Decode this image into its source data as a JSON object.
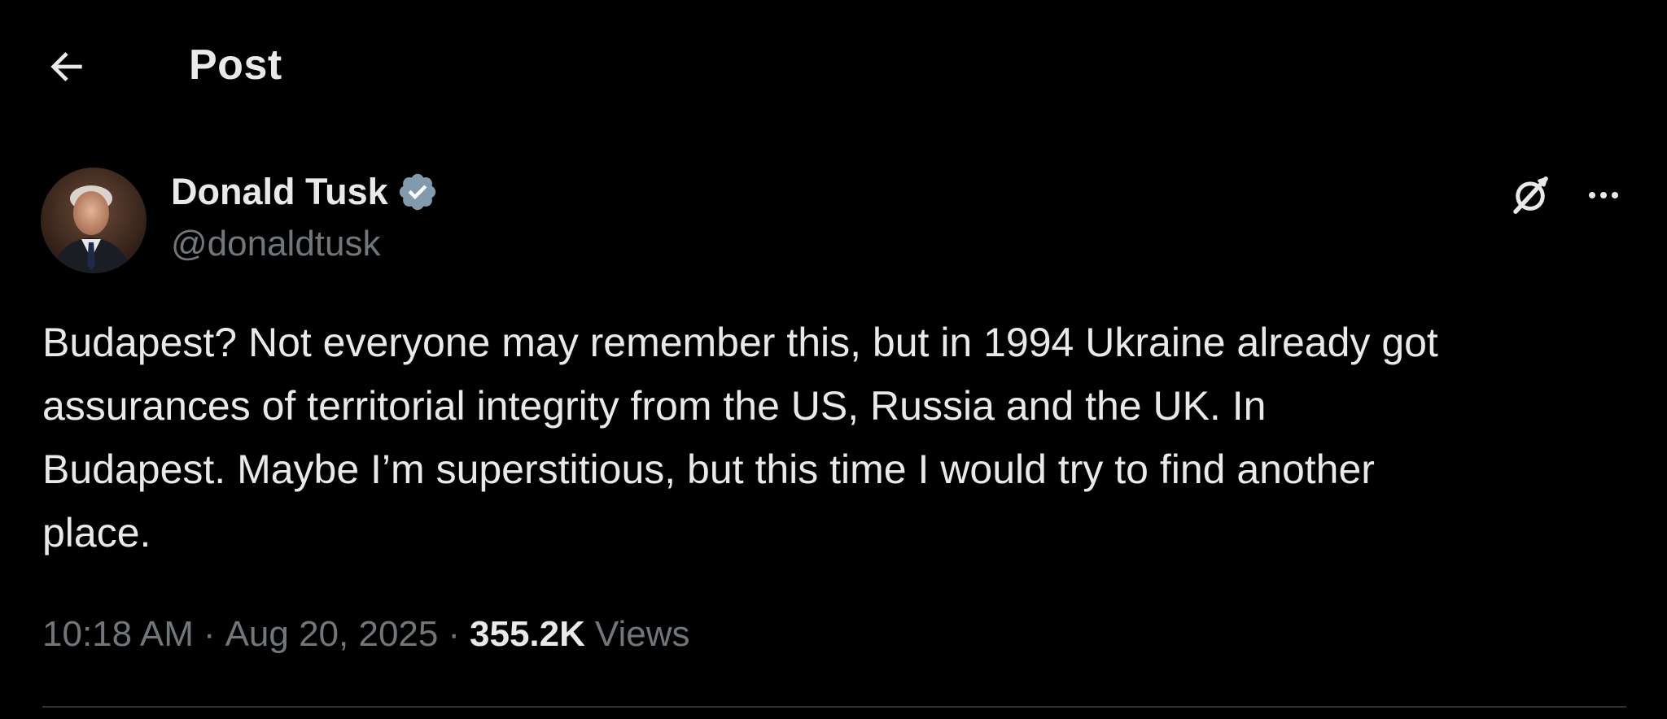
{
  "header": {
    "back_icon": "arrow-left-icon",
    "title": "Post"
  },
  "author": {
    "name": "Donald Tusk",
    "handle": "@donaldtusk",
    "verified_icon": "verified-badge-icon",
    "verified_color": "#829aab",
    "avatar": "avatar-photo"
  },
  "actions": {
    "grok_icon": "grok-icon",
    "more_icon": "more-horizontal-icon"
  },
  "post": {
    "text": "Budapest? Not everyone may remember this, but in 1994 Ukraine already got\nassurances of territorial integrity from the US, Russia and the UK. In\nBudapest. Maybe I’m superstitious, but this time I would try to find another\nplace."
  },
  "meta": {
    "time": "10:18 AM",
    "separator": "·",
    "date": "Aug 20, 2025",
    "views_count": "355.2K",
    "views_label": "Views"
  },
  "colors": {
    "background": "#000000",
    "text_primary": "#e7e9ea",
    "text_secondary": "#71767b",
    "divider": "#2f3336"
  }
}
